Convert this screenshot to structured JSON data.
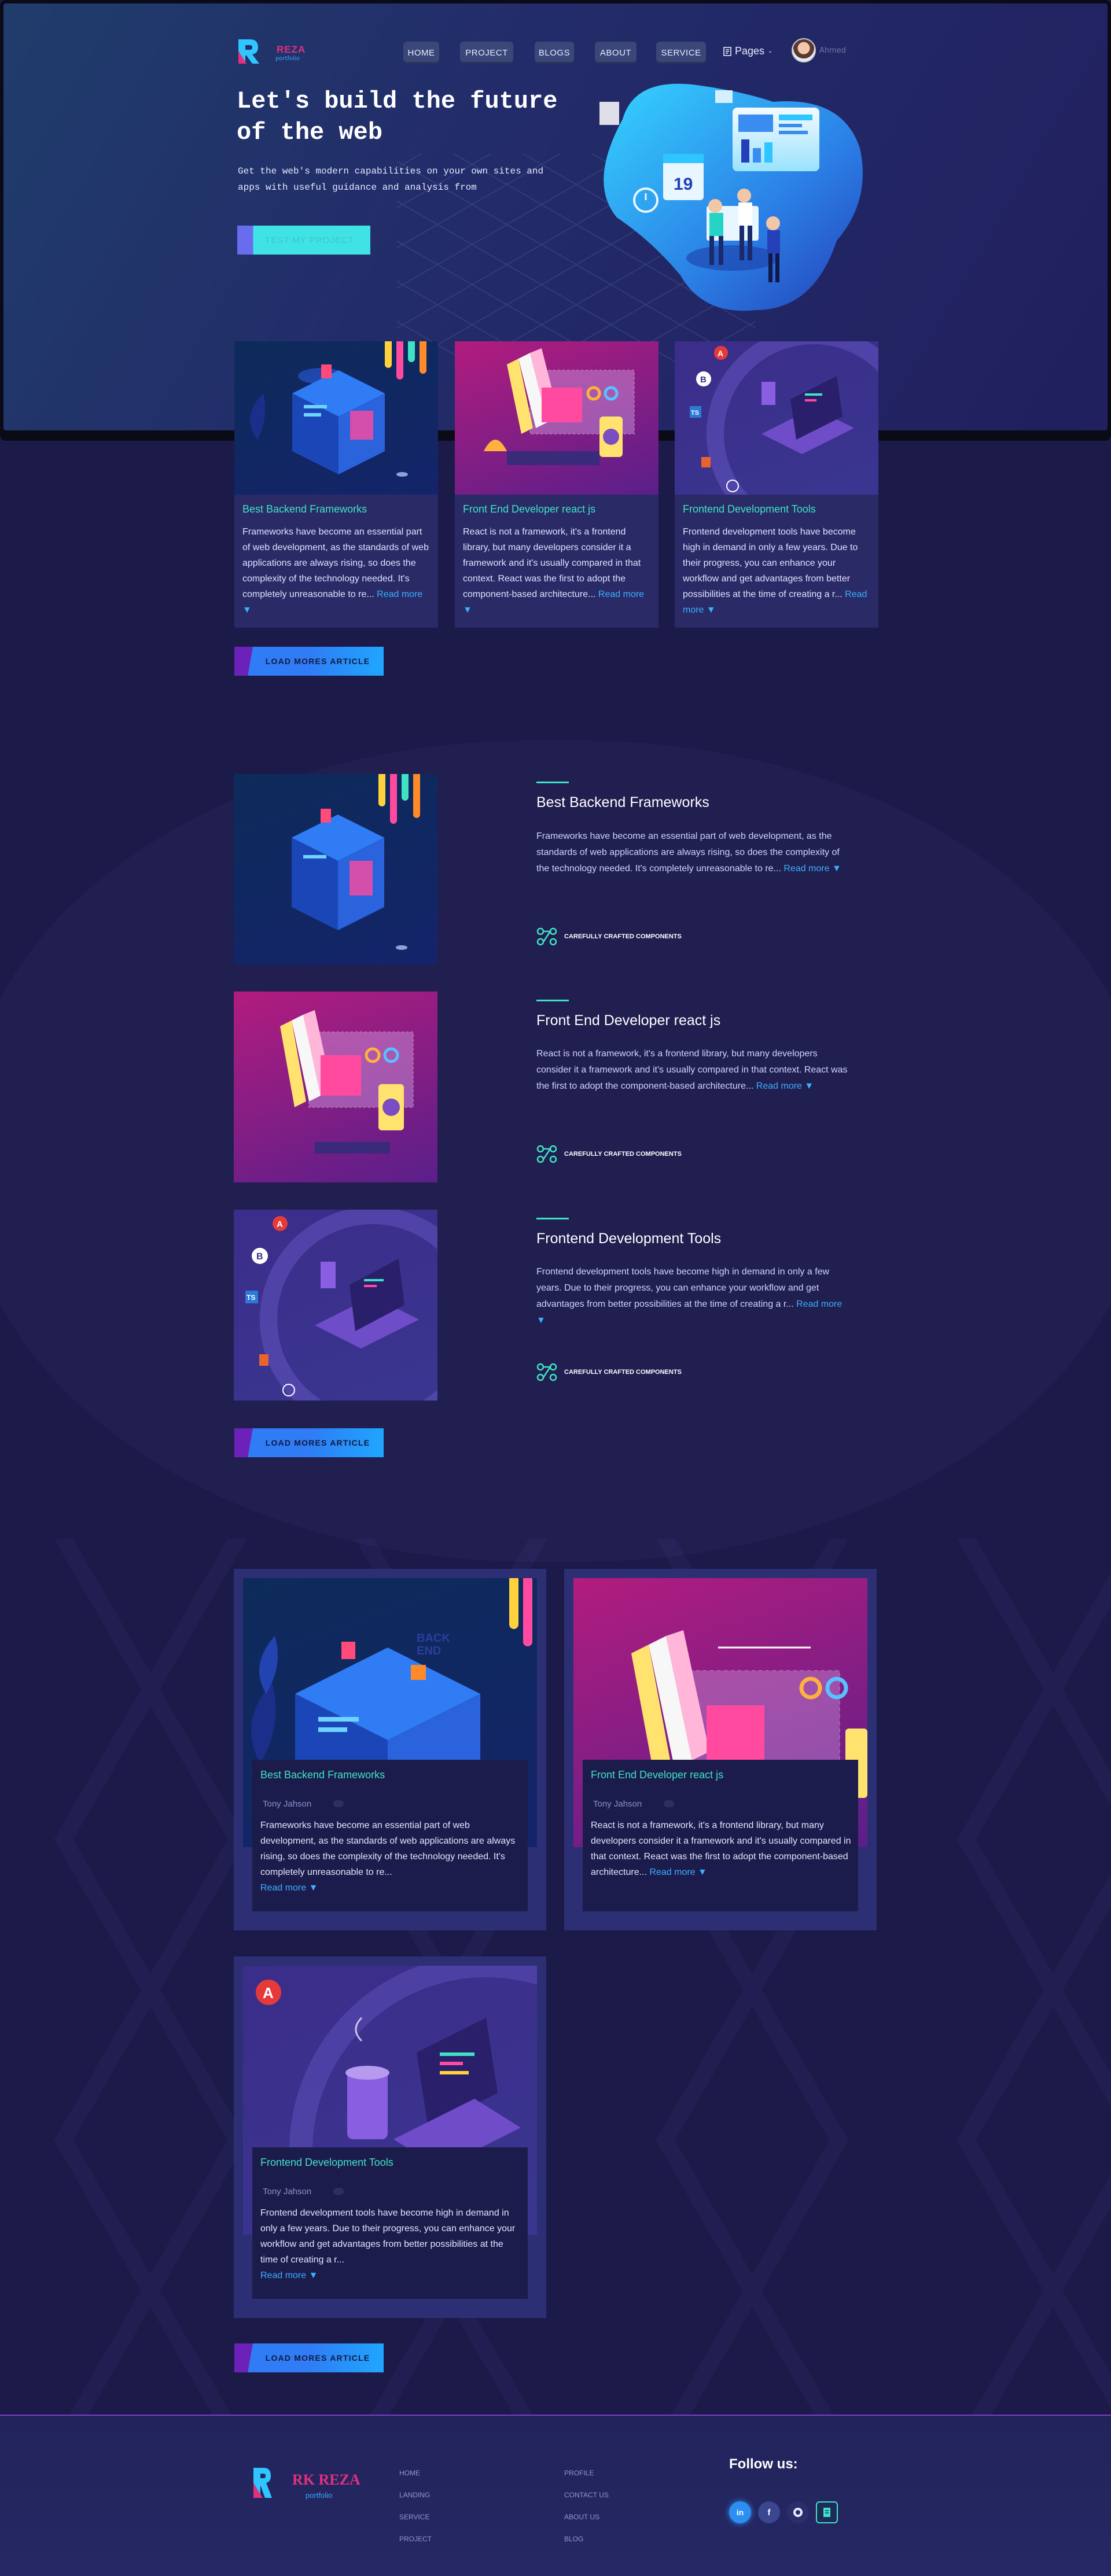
{
  "header": {
    "brand": "REZA",
    "brand_sub": "portfolio",
    "nav": [
      "HOME",
      "PROJECT",
      "BLOGS",
      "ABOUT",
      "SERVICE"
    ],
    "pages_label": "Pages",
    "user_name": "Ahmed"
  },
  "hero": {
    "title": "Let's build the future of the web",
    "subtitle": "Get the web's modern capabilities on your own sites and apps with useful guidance and analysis from",
    "cta": "TEST MY PROJECT"
  },
  "read_more": "Read more",
  "load_more": "LOAD MORES ARTICLE",
  "articles": [
    {
      "title": "Best Backend Frameworks",
      "excerpt": "Frameworks have become an essential part of web development, as the standards of web applications are always rising, so does the complexity of the technology needed. It's completely unreasonable to re..."
    },
    {
      "title": "Front End Developer react js",
      "excerpt": "React is not a framework, it's a frontend library, but many developers consider it a framework and it's usually compared in that context. React was the first to adopt the component-based architecture..."
    },
    {
      "title": "Frontend Development Tools",
      "excerpt": "Frontend development tools have become high in demand in only a few years. Due to their progress, you can enhance your workflow and get advantages from better possibilities at the time of creating a r..."
    }
  ],
  "feature_label": "CAREFULLY CRAFTED COMPONENTS",
  "author": "Tony Jahson",
  "footer": {
    "brand": "RK REZA",
    "brand_sub": "portfolio",
    "col1": [
      "HOME",
      "LANDING",
      "SERVICE",
      "PROJECT"
    ],
    "col2": [
      "PROFILE",
      "CONTACT US",
      "ABOUT US",
      "BLOG"
    ],
    "follow": "Follow us:",
    "social": [
      "linkedin-icon",
      "facebook-icon",
      "github-icon",
      "document-icon"
    ]
  }
}
